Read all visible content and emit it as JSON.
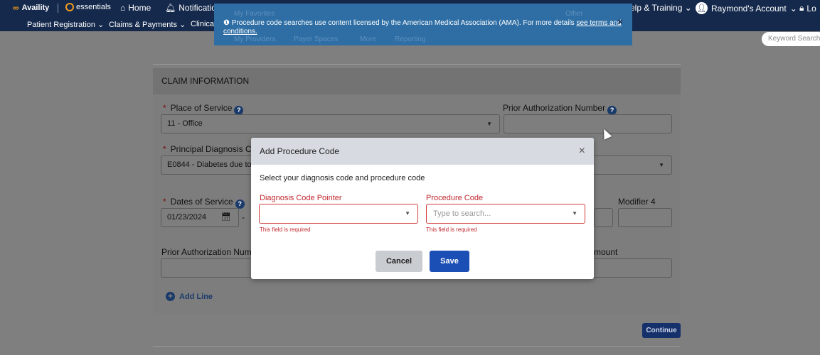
{
  "topnav": {
    "brand": "Availity",
    "essentials": "essentials",
    "home": "Home",
    "notifications": "Notifications",
    "help": "elp & Training",
    "account": "Raymond's Account",
    "logout": "Lo",
    "row2": [
      "Patient Registration",
      "Claims & Payments",
      "Clinical"
    ],
    "keyword_search_placeholder": "Keyword Search"
  },
  "banner": {
    "ghost_row1": "My Favorites",
    "ghost_row1b": "Other",
    "ghost_row2": [
      "My Providers",
      "Payer Spaces",
      "More",
      "Reporting"
    ],
    "message": "Procedure code searches use content licensed by the American Medical Association (AMA). For more details",
    "link": "see terms and conditions.",
    "close": "×"
  },
  "card": {
    "header": "CLAIM INFORMATION",
    "place_of_service_label": "Place of Service",
    "place_of_service_value": "11 - Office",
    "prior_auth_label": "Prior Authorization Number",
    "principal_dx_label": "Principal Diagnosis C",
    "principal_dx_value": "E0844 - Diabetes due to",
    "dates_label": "Dates of Service",
    "date_from": "01/23/2024",
    "date_sep": "-",
    "modifier4_label": "Modifier 4",
    "prior_auth_line_label": "Prior Authorization Numbe",
    "amount_label": "mount",
    "add_line": "Add Line",
    "continue": "Continue"
  },
  "modal": {
    "title": "Add Procedure Code",
    "close": "×",
    "subtitle": "Select your diagnosis code and procedure code",
    "dx_pointer_label": "Diagnosis Code Pointer",
    "procedure_label": "Procedure Code",
    "procedure_placeholder": "Type to search...",
    "required_error": "This field is required",
    "cancel": "Cancel",
    "save": "Save"
  }
}
